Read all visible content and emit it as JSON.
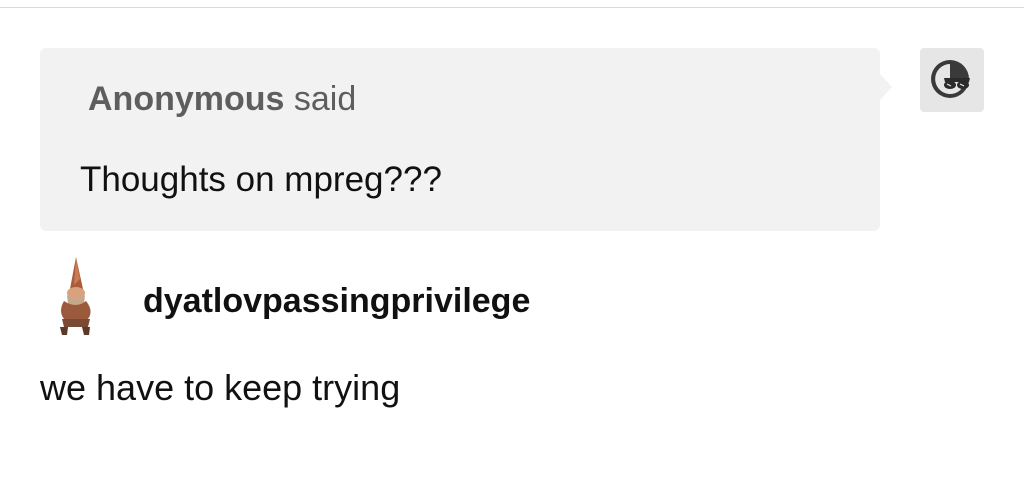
{
  "ask": {
    "asker_name": "Anonymous",
    "asker_suffix": " said",
    "question": "Thoughts on mpreg???",
    "avatar_icon": "anonymous-sunglasses-icon"
  },
  "answer": {
    "blog_name": "dyatlovpassingprivilege",
    "avatar_icon": "gnome-figure-avatar",
    "text": "we have to keep trying"
  },
  "colors": {
    "bubble_bg": "#f2f2f2",
    "asker_text": "#5e5e5e",
    "body_text": "#111111"
  }
}
